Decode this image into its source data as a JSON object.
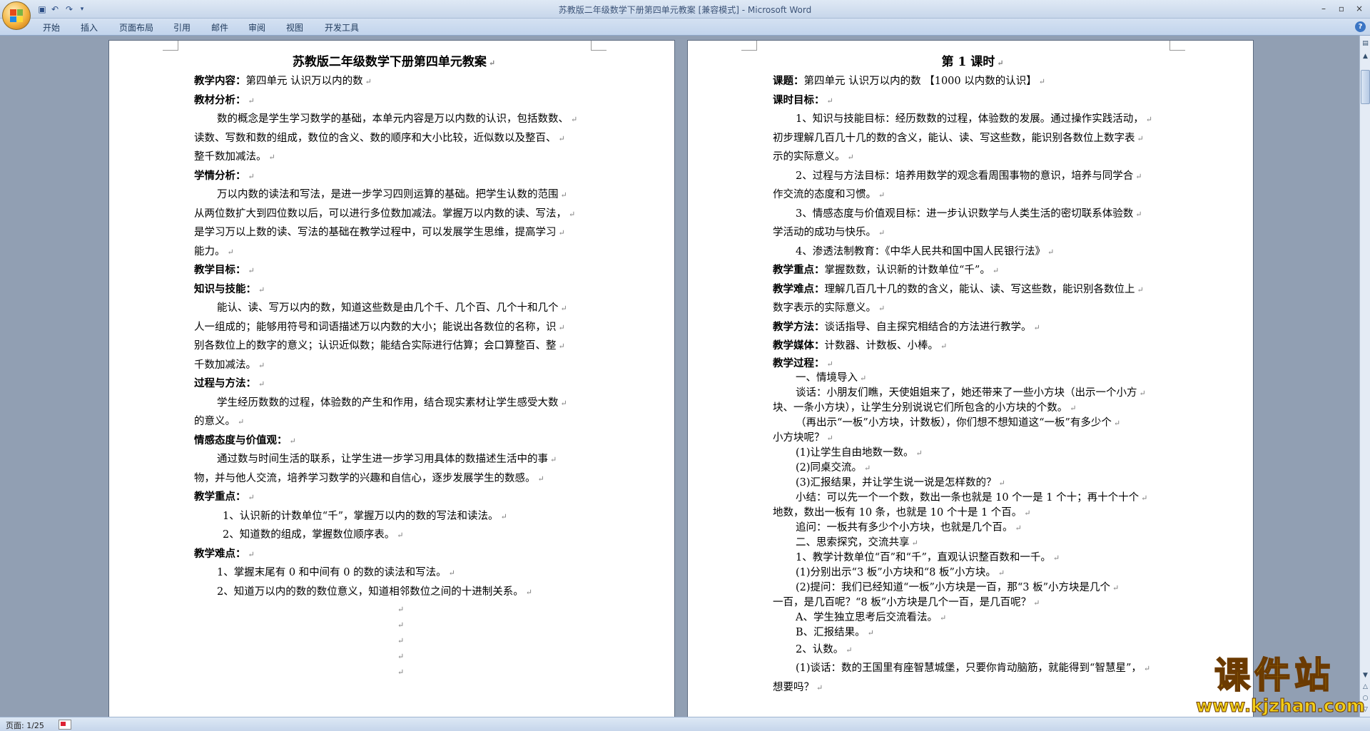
{
  "window": {
    "title": "苏教版二年级数学下册第四单元教案 [兼容模式] - Microsoft Word",
    "controls": {
      "minimize": "–",
      "restore": "▫",
      "close": "×"
    }
  },
  "quick_access": {
    "save_icon": "save-icon",
    "undo_icon": "undo-icon",
    "redo_icon": "redo-icon",
    "customize_icon": "dropdown-icon"
  },
  "ribbon": {
    "tabs": [
      "开始",
      "插入",
      "页面布局",
      "引用",
      "邮件",
      "审阅",
      "视图",
      "开发工具"
    ],
    "help": "?"
  },
  "page1": {
    "title": "苏教版二年级数学下册第四单元教案",
    "lines": [
      {
        "label": "教学内容：",
        "text": "第四单元   认识万以内的数"
      },
      {
        "label": "教材分析：",
        "text": ""
      },
      {
        "text": "数的概念是学生学习数学的基础，本单元内容是万以内数的认识，包括数数、",
        "indent": true
      },
      {
        "text": "读数、写数和数的组成，数位的含义、数的顺序和大小比较，近似数以及整百、"
      },
      {
        "text": "整千数加减法。"
      },
      {
        "label": "学情分析：",
        "text": ""
      },
      {
        "text": "万以内数的读法和写法，是进一步学习四则运算的基础。把学生认数的范围",
        "indent": true
      },
      {
        "text": "从两位数扩大到四位数以后，可以进行多位数加减法。掌握万以内数的读、写法，"
      },
      {
        "text": "是学习万以上数的读、写法的基础在教学过程中，可以发展学生思维，提高学习"
      },
      {
        "text": "能力。"
      },
      {
        "label": "教学目标：",
        "text": ""
      },
      {
        "label": "知识与技能：",
        "text": ""
      },
      {
        "text": "能认、读、写万以内的数，知道这些数是由几个千、几个百、几个十和几个",
        "indent": true
      },
      {
        "text": "人一组成的；能够用符号和词语描述万以内数的大小；能说出各数位的名称，识"
      },
      {
        "text": "别各数位上的数字的意义；认识近似数；能结合实际进行估算；会口算整百、整"
      },
      {
        "text": "千数加减法。"
      },
      {
        "label": "过程与方法：",
        "text": ""
      },
      {
        "text": "学生经历数数的过程，体验数的产生和作用，结合现实素材让学生感受大数",
        "indent": true
      },
      {
        "text": "的意义。"
      },
      {
        "label": "情感态度与价值观：",
        "text": ""
      },
      {
        "text": "通过数与时间生活的联系，让学生进一步学习用具体的数描述生活中的事",
        "indent": true
      },
      {
        "text": "物，并与他人交流，培养学习数学的兴趣和自信心，逐步发展学生的数感。"
      },
      {
        "label": "教学重点：",
        "text": ""
      },
      {
        "text": "1、认识新的计数单位“千”，掌握万以内的数的写法和读法。",
        "indent2": true
      },
      {
        "text": "2、知道数的组成，掌握数位顺序表。",
        "indent2": true
      },
      {
        "label": "教学难点：",
        "text": ""
      },
      {
        "text": "1、掌握末尾有 0 和中间有 0 的数的读法和写法。",
        "indent": true
      },
      {
        "text": "2、知道万以内的数的数位意义，知道相邻数位之间的十进制关系。",
        "indent": true
      }
    ],
    "trailing_marks": 5
  },
  "page2": {
    "title": "第 1 课时",
    "lines": [
      {
        "label": "课题：",
        "text": "第四单元      认识万以内的数  【1000 以内数的认识】",
        "size": "n"
      },
      {
        "label": "课时目标：",
        "text": "",
        "size": "n"
      },
      {
        "text": "1、知识与技能目标：经历数数的过程，体验数的发展。通过操作实践活动，",
        "indent": true,
        "size": "n"
      },
      {
        "text": "初步理解几百几十几的数的含义，能认、读、写这些数，能识别各数位上数字表",
        "size": "n"
      },
      {
        "text": "示的实际意义。",
        "size": "n"
      },
      {
        "text": "2、过程与方法目标：培养用数学的观念看周围事物的意识，培养与同学合",
        "indent": true,
        "size": "n"
      },
      {
        "text": "作交流的态度和习惯。",
        "size": "n"
      },
      {
        "text": "3、情感态度与价值观目标：进一步认识数学与人类生活的密切联系体验数",
        "indent": true,
        "size": "n"
      },
      {
        "text": "学活动的成功与快乐。",
        "size": "n"
      },
      {
        "text": "4、渗透法制教育：《中华人民共和国中国人民银行法》",
        "indent": true,
        "size": "n"
      },
      {
        "label": "教学重点：",
        "text": "掌握数数，认识新的计数单位“千”。",
        "size": "n"
      },
      {
        "label": "教学难点：",
        "text": "理解几百几十几的数的含义，能认、读、写这些数，能识别各数位上",
        "size": "n"
      },
      {
        "text": "数字表示的实际意义。",
        "size": "n"
      },
      {
        "label": "教学方法：",
        "text": "谈话指导、自主探究相结合的方法进行教学。",
        "size": "n"
      },
      {
        "label": "教学媒体：",
        "text": "计数器、计数板、小棒。",
        "size": "n"
      },
      {
        "label": "教学过程：",
        "text": "",
        "size": "s"
      },
      {
        "text": "一、情境导入",
        "indent": true,
        "size": "s"
      },
      {
        "text": "谈话：小朋友们瞧，天使姐姐来了，她还带来了一些小方块（出示一个小方",
        "indent": true,
        "size": "s"
      },
      {
        "text": "块、一条小方块），让学生分别说说它们所包含的小方块的个数。",
        "size": "s"
      },
      {
        "text": "（再出示“一板”小方块，计数板），你们想不想知道这“一板”有多少个",
        "indent": true,
        "size": "s"
      },
      {
        "text": "小方块呢？",
        "size": "s"
      },
      {
        "text": "(1)让学生自由地数一数。",
        "indent": true,
        "size": "s"
      },
      {
        "text": "(2)同桌交流。",
        "indent": true,
        "size": "s"
      },
      {
        "text": "(3)汇报结果，并让学生说一说是怎样数的？",
        "indent": true,
        "size": "s"
      },
      {
        "text": "小结：可以先一个一个数，数出一条也就是 10 个一是 1 个十；再十个十个",
        "indent": true,
        "size": "s"
      },
      {
        "text": "地数，数出一板有 10 条，也就是 10 个十是 1 个百。",
        "size": "s"
      },
      {
        "text": "追问：一板共有多少个小方块，也就是几个百。",
        "indent": true,
        "size": "s"
      },
      {
        "text": "二、思索探究，交流共享",
        "indent": true,
        "size": "s"
      },
      {
        "text": "1、教学计数单位“百”和“千”，直观认识整百数和一千。",
        "indent": true,
        "size": "s"
      },
      {
        "text": "(1)分别出示“3 板”小方块和“8 板”小方块。",
        "indent": true,
        "size": "s"
      },
      {
        "text": "(2)提问：我们已经知道“一板”小方块是一百，那“3 板”小方块是几个",
        "indent": true,
        "size": "s"
      },
      {
        "text": "一百，是几百呢？“8 板”小方块是几个一百，是几百呢？",
        "size": "s"
      },
      {
        "text": "A、学生独立思考后交流看法。",
        "indent": true,
        "size": "s"
      },
      {
        "text": "B、汇报结果。",
        "indent": true,
        "size": "s"
      },
      {
        "text": "2、认数。",
        "indent": true,
        "size": "n"
      },
      {
        "text": "(1)谈话：数的王国里有座智慧城堡，只要你肯动脑筋，就能得到“智慧星”，",
        "indent": true,
        "size": "n"
      },
      {
        "text": "想要吗？",
        "size": "n"
      }
    ]
  },
  "paragraph_mark": "↵",
  "statusbar": {
    "page_count": "页面: 1/25"
  },
  "watermark": {
    "name": "课件站",
    "url": "www.kjzhan.com"
  }
}
